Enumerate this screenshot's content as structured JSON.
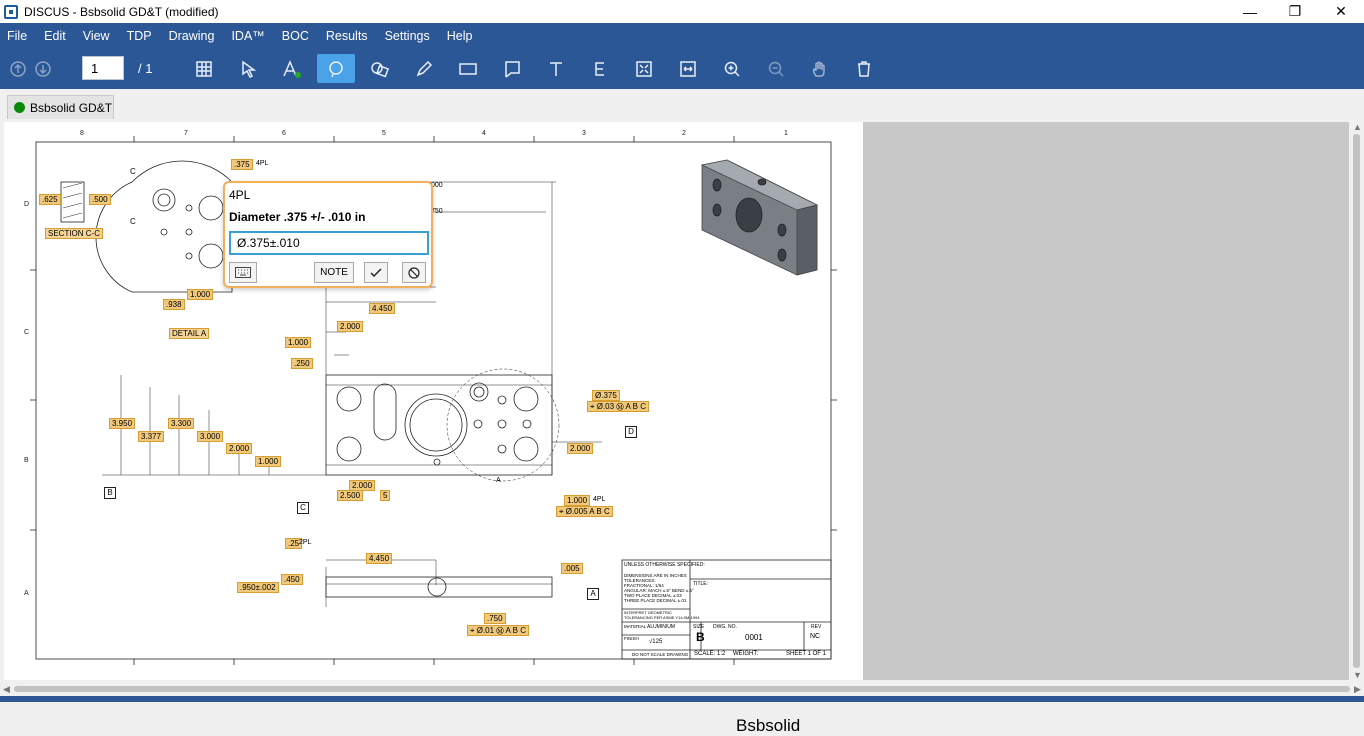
{
  "window": {
    "title": "DISCUS - Bsbsolid GD&T (modified)",
    "minimize": "—",
    "restore": "❐",
    "close": "✕"
  },
  "menu": [
    "File",
    "Edit",
    "View",
    "TDP",
    "Drawing",
    "IDA™",
    "BOC",
    "Results",
    "Settings",
    "Help"
  ],
  "toolbar": {
    "page_value": "1",
    "page_total": "/ 1",
    "icons": [
      "arrow-up-icon",
      "arrow-down-icon",
      "table-icon",
      "select-icon",
      "text-style-icon",
      "lasso-icon",
      "shapes-icon",
      "pencil-icon",
      "rectangle-icon",
      "flag-icon",
      "text-icon",
      "e-icon",
      "fit-icon",
      "fit-width-icon",
      "zoom-in-icon",
      "zoom-out-icon",
      "pan-icon",
      "trash-icon"
    ],
    "selected": "lasso-icon"
  },
  "tab": {
    "label": "Bsbsolid GD&T",
    "status_color": "#0a8a0a"
  },
  "popup": {
    "label": "4PL",
    "description": "Diameter .375 +/- .010 in",
    "value": "Ø.375±.010",
    "note_button": "NOTE",
    "keyboard_icon": "keyboard-icon",
    "ok_icon": "check-icon",
    "cancel_icon": "cancel-icon"
  },
  "drawing": {
    "zones_top": [
      "8",
      "7",
      "6",
      "5",
      "4",
      "3",
      "2",
      "1"
    ],
    "zones_side": [
      "D",
      "C",
      "B",
      "A"
    ],
    "dimensions": [
      {
        "id": "d1",
        "text": ".375"
      },
      {
        "id": "d2",
        "text": ".625"
      },
      {
        "id": "d3",
        "text": ".500"
      },
      {
        "id": "d4",
        "text": "1.000"
      },
      {
        "id": "d5",
        "text": ".938"
      },
      {
        "id": "d6",
        "text": "4.450"
      },
      {
        "id": "d7",
        "text": "2.000"
      },
      {
        "id": "d8",
        "text": "1.000"
      },
      {
        "id": "d9",
        "text": ".250"
      },
      {
        "id": "d10",
        "text": "3.950"
      },
      {
        "id": "d11",
        "text": "3.377"
      },
      {
        "id": "d12",
        "text": "3.300"
      },
      {
        "id": "d13",
        "text": "3.000"
      },
      {
        "id": "d14",
        "text": "2.000"
      },
      {
        "id": "d15",
        "text": "1.000"
      },
      {
        "id": "d16",
        "text": "2.000"
      },
      {
        "id": "d17",
        "text": "2.500"
      },
      {
        "id": "d18",
        "text": "5"
      },
      {
        "id": "d19",
        "text": "2.000"
      },
      {
        "id": "d20",
        "text": "1.000"
      },
      {
        "id": "d21",
        "text": ".25"
      },
      {
        "id": "d22",
        "text": "4.450"
      },
      {
        "id": "d23",
        "text": ".450"
      },
      {
        "id": "d24",
        "text": ".950±.002"
      },
      {
        "id": "d25",
        "text": ".750"
      },
      {
        "id": "d26",
        "text": ".005"
      }
    ],
    "fcf": [
      {
        "id": "f1",
        "text": "⌖ Ø.03 Ⓜ A B C"
      },
      {
        "id": "f2",
        "text": "⌖ Ø.005 A B C"
      },
      {
        "id": "f3",
        "text": "⌖ Ø.01 Ⓜ A B C"
      }
    ],
    "labels": {
      "section": "SECTION C-C",
      "detail": "DETAIL A",
      "pl4": "4PL",
      "pl2": "2PL",
      "d1": ".000",
      "d2": ".750",
      "hole": "Ø.375",
      "datum_b": "B",
      "datum_c": "C",
      "datum_d": "D",
      "datum_a": "A",
      "cut_c": "C",
      "cut_a": "A"
    },
    "title_block": {
      "notes": "UNLESS OTHERWISE SPECIFIED:",
      "dims": "DIMENSIONS ARE IN INCHES",
      "tol": "TOLERANCES:",
      "frac": "FRACTIONAL: 1/64",
      "ang": "ANGULAR: MACH ±.5° BEND ±.5°",
      "two": "TWO PLACE DECIMAL ±.03",
      "three": "THREE PLACE DECIMAL ±.01",
      "interp": "INTERPRET GEOMETRIC",
      "interp2": "TOLERANCING PER ASME Y14.5M-1994",
      "material_label": "MATERIAL",
      "material": "ALUMINIUM",
      "finish_label": "FINISH",
      "finish": "√125",
      "noscale": "DO NOT SCALE DRAWING",
      "title_label": "TITLE:",
      "title": "Bsbsolid",
      "size_label": "SIZE",
      "size": "B",
      "dwg_label": "DWG.  NO.",
      "dwg": "0001",
      "rev_label": "REV",
      "rev": "NC",
      "scale": "SCALE: 1:2",
      "weight": "WEIGHT:",
      "sheet": "SHEET 1 OF 1"
    }
  }
}
